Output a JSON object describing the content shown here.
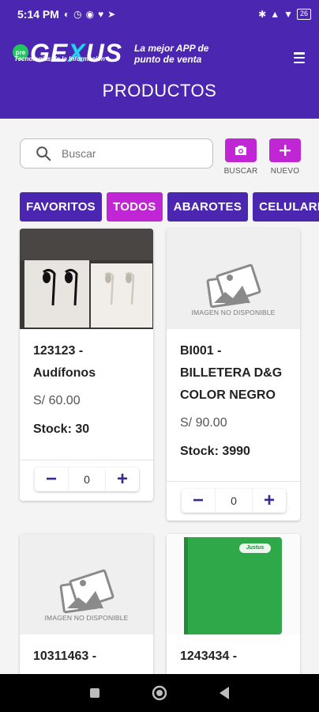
{
  "status_bar": {
    "time": "5:14 PM",
    "battery": "26"
  },
  "header": {
    "logo_pre": "pre",
    "logo_text_a": "GE",
    "logo_text_accent": "X",
    "logo_text_b": "US",
    "logo_subtitle": "Tecnologías de la Información",
    "tagline": "La mejor APP de punto de venta",
    "title": "PRODUCTOS"
  },
  "search": {
    "placeholder": "Buscar"
  },
  "actions": {
    "scan_label": "BUSCAR",
    "new_label": "NUEVO"
  },
  "tabs": [
    {
      "label": "FAVORITOS",
      "active": false
    },
    {
      "label": "TODOS",
      "active": true
    },
    {
      "label": "ABAROTES",
      "active": false
    },
    {
      "label": "CELULARES",
      "active": false
    }
  ],
  "products": [
    {
      "title": "123123 -\nAudífonos",
      "price": "S/ 60.00",
      "stock": "Stock: 30",
      "qty": "0",
      "image": "earphones-photo"
    },
    {
      "title": "BI001 -\nBILLETERA D&G\nCOLOR NEGRO",
      "price": "S/ 90.00",
      "stock": "Stock: 3990",
      "qty": "0",
      "image": "placeholder"
    },
    {
      "title": "10311463 -",
      "image": "placeholder"
    },
    {
      "title": "1243434 -",
      "image": "green-notebook-photo"
    }
  ],
  "placeholder_text": "IMAGEN NO DISPONIBLE",
  "notebook_brand": "Justus",
  "colors": {
    "primary": "#4b27b1",
    "accent": "#c026d3",
    "logo_accent": "#22d3ee"
  }
}
